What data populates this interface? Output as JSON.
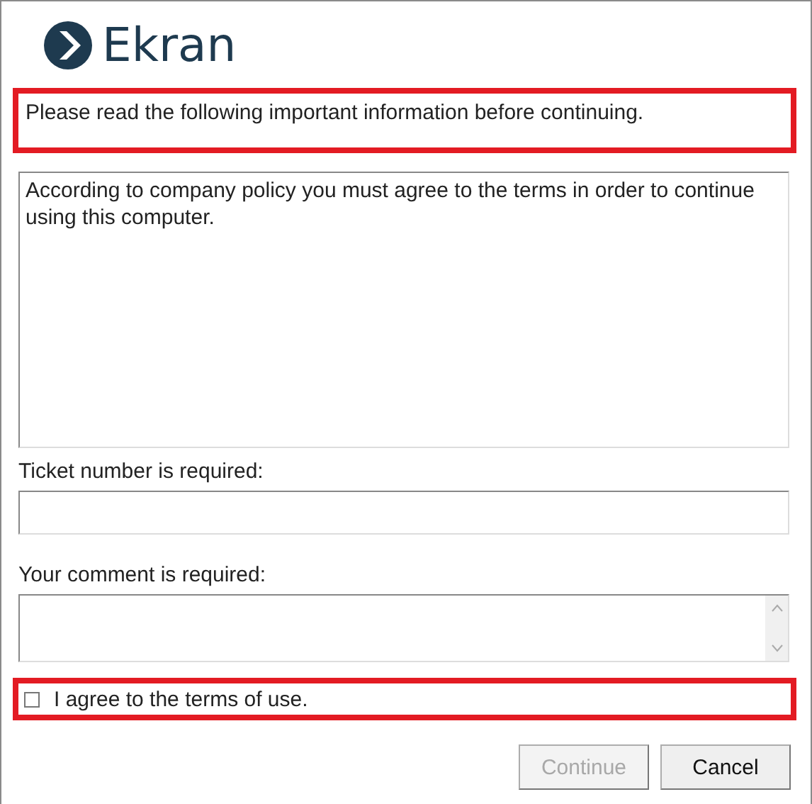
{
  "logo": {
    "text": "Ekran"
  },
  "notice": {
    "text": "Please read the following important information before continuing.",
    "highlighted": true
  },
  "terms": {
    "text": "According to company policy you must agree to the terms in order to continue using this computer."
  },
  "ticket": {
    "label": "Ticket number is required:"
  },
  "comment": {
    "label": "Your comment is required:"
  },
  "agree": {
    "label": "I agree to the terms of use.",
    "checked": false,
    "highlighted": true
  },
  "buttons": [
    {
      "label": "Continue",
      "disabled": true
    },
    {
      "label": "Cancel",
      "disabled": false
    }
  ]
}
